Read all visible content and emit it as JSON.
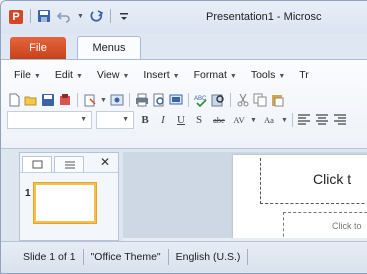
{
  "window": {
    "title": "Presentation1 - Microsc",
    "app_icon_letter": "P"
  },
  "qat": {
    "icons": [
      "save-icon",
      "undo-icon",
      "redo-icon",
      "customize-qat-icon"
    ]
  },
  "tabs": {
    "file": "File",
    "menus": "Menus"
  },
  "menubar": {
    "items": [
      "File",
      "Edit",
      "View",
      "Insert",
      "Format",
      "Tools",
      "Tr"
    ]
  },
  "toolbar": {
    "format": {
      "bold": "B",
      "italic": "I",
      "underline": "U",
      "shadow": "S",
      "strikethrough": "abe",
      "char_spacing": "AV",
      "change_case": "Aa"
    }
  },
  "panel": {
    "slide_number": "1",
    "close": "✕"
  },
  "slide": {
    "title_placeholder": "Click t",
    "subtitle_placeholder": "Click to"
  },
  "status": {
    "slide": "Slide 1 of 1",
    "theme": "\"Office Theme\"",
    "language": "English (U.S.)"
  },
  "colors": {
    "file_tab": "#d24726",
    "accent": "#f4c04b",
    "frame": "#dfe7f2"
  }
}
